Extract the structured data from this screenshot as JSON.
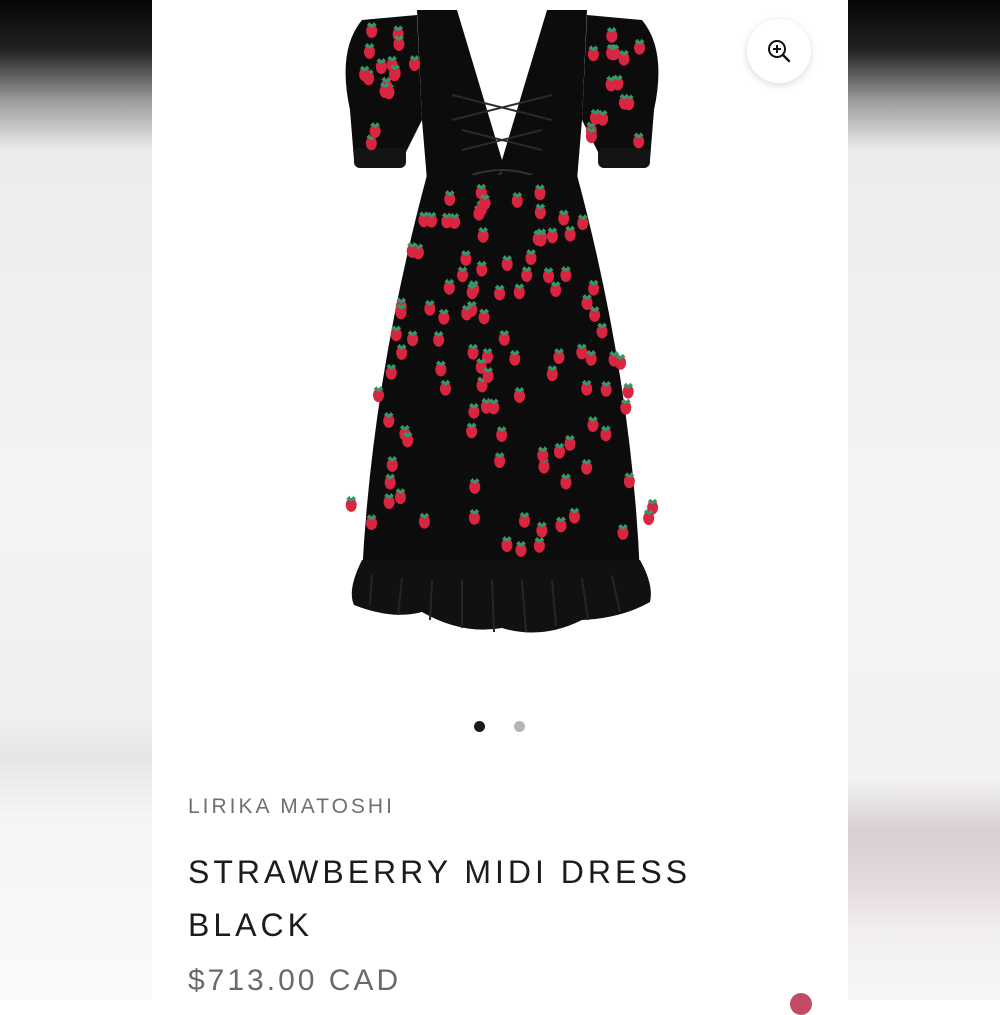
{
  "product": {
    "brand": "LIRIKA MATOSHI",
    "title": "STRAWBERRY MIDI DRESS BLACK",
    "price": "$713.00 CAD"
  },
  "gallery": {
    "image_count": 2,
    "active_index": 0,
    "zoom_icon": "zoom-in-icon"
  },
  "colors": {
    "dress": "#0c0c0c",
    "strawberry": "#d9253f",
    "leaf": "#2f9a6a",
    "dot_active": "#1a1a1a",
    "dot_inactive": "#b5b5b5",
    "brand_text": "#6f6f6f",
    "title_text": "#1c1c1c"
  }
}
